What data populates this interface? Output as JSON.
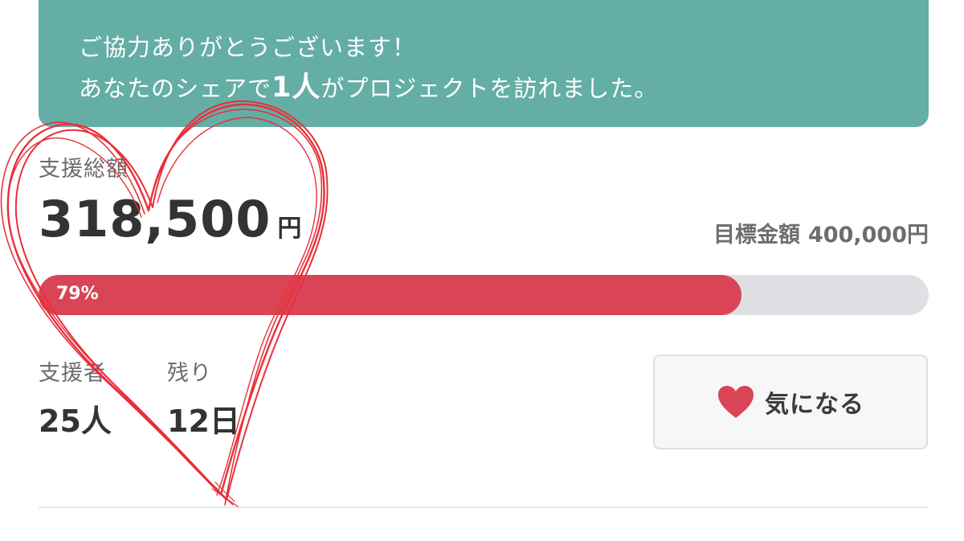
{
  "banner": {
    "line1": "ご協力ありがとうございます！",
    "line2_prefix": "あなたのシェアで",
    "line2_count": "1人",
    "line2_suffix": "がプロジェクトを訪れました。"
  },
  "funding": {
    "total_label": "支援総額",
    "total_amount": "318,500",
    "total_unit": "円",
    "goal_label": "目標金額",
    "goal_amount": "400,000円",
    "progress_text": "79%",
    "progress_fraction": 0.79
  },
  "stats": {
    "supporters_label": "支援者",
    "supporters_value": "25人",
    "remaining_label": "残り",
    "remaining_value": "12日"
  },
  "favorite_button": {
    "label": "気になる",
    "icon": "heart-icon"
  },
  "colors": {
    "banner": "#64aea6",
    "progress_fill": "#d94556",
    "progress_track": "#dfe0e3",
    "heart": "#d94556",
    "annotation_scribble": "#e8303a"
  }
}
